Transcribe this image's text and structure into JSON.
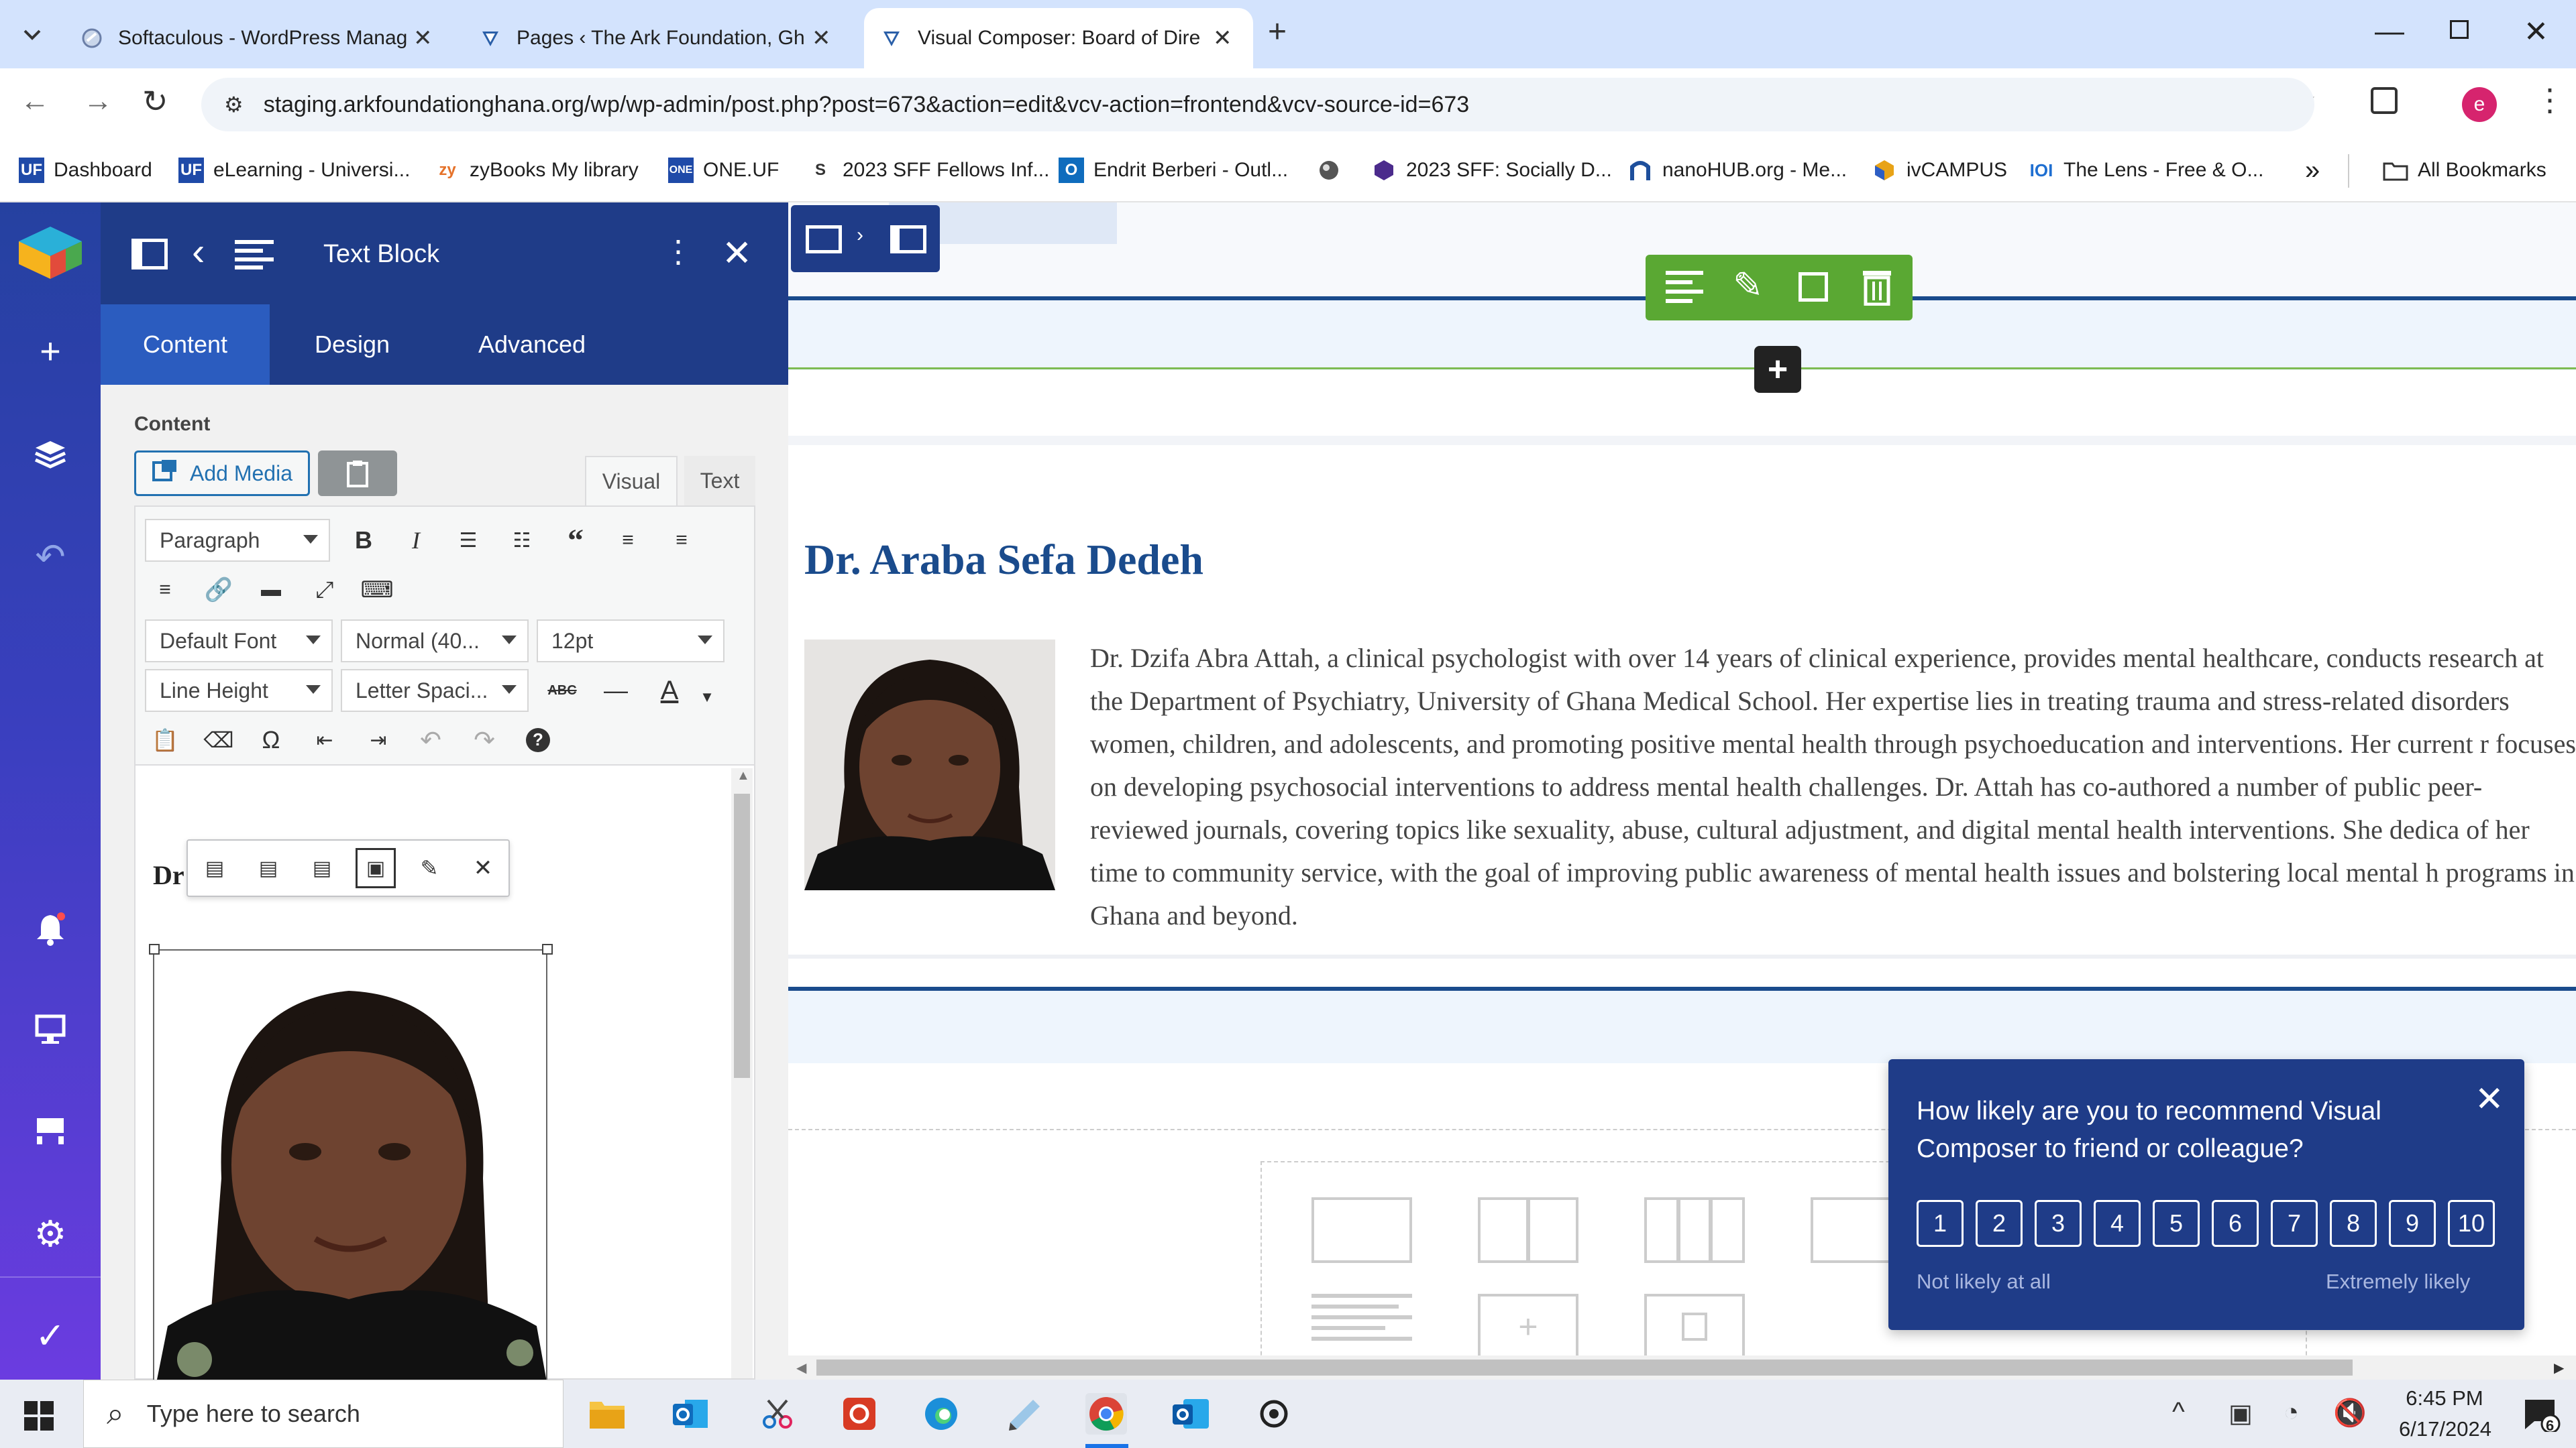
{
  "browser": {
    "tabs": [
      {
        "title": "Softaculous - WordPress Manag",
        "icon": "softaculous-icon"
      },
      {
        "title": "Pages ‹ The Ark Foundation, Gh",
        "icon": "wordpress-icon"
      },
      {
        "title": "Visual Composer: Board of Dire",
        "icon": "wordpress-icon"
      }
    ],
    "url": "staging.arkfoundationghana.org/wp/wp-admin/post.php?post=673&action=edit&vcv-action=frontend&vcv-source-id=673",
    "bookmarks": [
      {
        "label": "Dashboard",
        "icon": "UF"
      },
      {
        "label": "eLearning - Universi...",
        "icon": "UF"
      },
      {
        "label": "zyBooks My library",
        "icon": "zy"
      },
      {
        "label": "ONE.UF",
        "icon": "ONE"
      },
      {
        "label": "2023 SFF Fellows Inf...",
        "icon": "S"
      },
      {
        "label": "Endrit Berberi - Outl...",
        "icon": "O"
      },
      {
        "label": "",
        "icon": "globe"
      },
      {
        "label": "2023 SFF: Socially D...",
        "icon": "cube"
      },
      {
        "label": "nanoHUB.org - Me...",
        "icon": "n"
      },
      {
        "label": "ivCAMPUS",
        "icon": "iv"
      },
      {
        "label": "The Lens - Free & O...",
        "icon": "lens"
      }
    ],
    "all_bookmarks": "All Bookmarks",
    "profile_initial": "e",
    "more_bookmarks": "»"
  },
  "panel": {
    "title": "Text Block",
    "tabs": [
      "Content",
      "Design",
      "Advanced"
    ],
    "content_label": "Content",
    "add_media": "Add Media",
    "visual_tab": "Visual",
    "text_tab": "Text",
    "format_select": "Paragraph",
    "font_select": "Default Font",
    "weight_select": "Normal (40...",
    "size_select": "12pt",
    "line_height_select": "Line Height",
    "letter_spacing_select": "Letter Spaci...",
    "editor_text_fragment": "Dr",
    "strike_label": "ABC"
  },
  "page": {
    "heading": "Dr. Araba Sefa Dedeh",
    "bio": "Dr. Dzifa Abra Attah, a clinical psychologist with over 14 years of clinical experience, provides mental healthcare, conducts research at the Department of Psychiatry, University of Ghana Medical School. Her expertise lies in treating trauma and stress-related disorders women, children, and adolescents, and promoting positive mental health through psychoeducation and interventions. Her current r focuses on developing psychosocial interventions to address mental health challenges. Dr. Attah has co-authored a number of public peer-reviewed journals, covering topics like sexuality, abuse, cultural adjustment, and digital mental health interventions. She dedica of her time to community service, with the goal of improving public awareness of mental health issues and bolstering local mental h programs in Ghana and beyond.",
    "heading_color": "#1a4b8c"
  },
  "survey": {
    "question": "How likely are you to recommend Visual Composer to friend or colleague?",
    "scores": [
      "1",
      "2",
      "3",
      "4",
      "5",
      "6",
      "7",
      "8",
      "9",
      "10"
    ],
    "low_label": "Not likely at all",
    "high_label": "Extremely likely",
    "bg": "#1f3c88"
  },
  "taskbar": {
    "search_placeholder": "Type here to search",
    "time": "6:45 PM",
    "date": "6/17/2024",
    "notification_count": "6"
  },
  "colors": {
    "vc_navy": "#1f3c88",
    "vc_green": "#5aa833",
    "chrome_tabbar": "#d3e3fd"
  }
}
